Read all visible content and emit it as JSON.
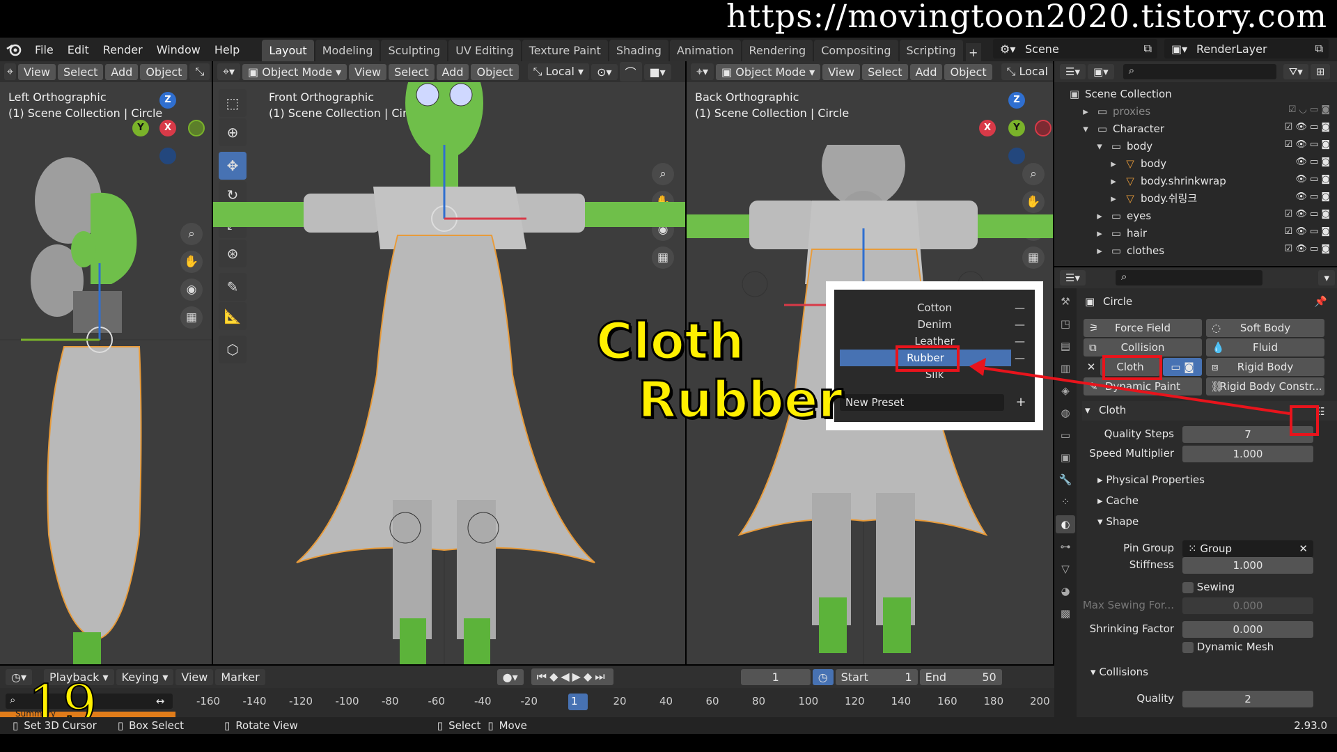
{
  "watermark_url": "https://movingtoon2020.tistory.com",
  "menu": {
    "items": [
      "File",
      "Edit",
      "Render",
      "Window",
      "Help"
    ]
  },
  "workspaces": [
    "Layout",
    "Modeling",
    "Sculpting",
    "UV Editing",
    "Texture Paint",
    "Shading",
    "Animation",
    "Rendering",
    "Compositing",
    "Scripting"
  ],
  "active_workspace": "Layout",
  "scene_name": "Scene",
  "render_layer": "RenderLayer",
  "viewports": {
    "left": {
      "menus": [
        "View",
        "Select",
        "Add",
        "Object"
      ],
      "title": "Left Orthographic",
      "subtitle": "(1) Scene Collection | Circle"
    },
    "front": {
      "mode": "Object Mode",
      "menus": [
        "View",
        "Select",
        "Add",
        "Object"
      ],
      "orientation": "Local",
      "title": "Front Orthographic",
      "subtitle": "(1) Scene Collection | Circle"
    },
    "back": {
      "mode": "Object Mode",
      "menus": [
        "View",
        "Select",
        "Add",
        "Object"
      ],
      "orientation": "Local",
      "title": "Back Orthographic",
      "subtitle": "(1) Scene Collection | Circle"
    }
  },
  "gizmo_labels": {
    "z": "Z",
    "y": "Y",
    "x": "X",
    "neg_y": "-Y",
    "neg_x": "X"
  },
  "outliner": {
    "root": "Scene Collection",
    "rows": [
      {
        "label": "proxies",
        "indent": 1
      },
      {
        "label": "Character",
        "indent": 1
      },
      {
        "label": "body",
        "indent": 2
      },
      {
        "label": "body",
        "indent": 3
      },
      {
        "label": "body.shrinkwrap",
        "indent": 3
      },
      {
        "label": "body.쉬링크",
        "indent": 3
      },
      {
        "label": "eyes",
        "indent": 2
      },
      {
        "label": "hair",
        "indent": 2
      },
      {
        "label": "clothes",
        "indent": 2
      }
    ]
  },
  "properties": {
    "object_name": "Circle",
    "physics_buttons": {
      "force_field": "Force Field",
      "soft_body": "Soft Body",
      "collision": "Collision",
      "fluid": "Fluid",
      "cloth": "Cloth",
      "rigid_body": "Rigid Body",
      "dynamic_paint": "Dynamic Paint",
      "rigid_body_constr": "Rigid Body Constr..."
    },
    "cloth_panel": "Cloth",
    "quality_steps_label": "Quality Steps",
    "quality_steps": "7",
    "speed_multiplier_label": "Speed Multiplier",
    "speed_multiplier": "1.000",
    "physical_properties": "Physical Properties",
    "cache": "Cache",
    "shape": "Shape",
    "pin_group_label": "Pin Group",
    "pin_group": "Group",
    "stiffness_label": "Stiffness",
    "stiffness": "1.000",
    "sewing": "Sewing",
    "max_sewing_label": "Max Sewing For...",
    "max_sewing": "0.000",
    "shrinking_label": "Shrinking Factor",
    "shrinking": "0.000",
    "dynamic_mesh": "Dynamic Mesh",
    "collisions": "Collisions",
    "quality_label": "Quality",
    "quality": "2"
  },
  "preset_popup": {
    "items": [
      "Cotton",
      "Denim",
      "Leather",
      "Rubber",
      "Silk"
    ],
    "selected": "Rubber",
    "new_preset": "New Preset"
  },
  "overlay": {
    "line1": "Cloth",
    "line2": "Rubber",
    "step_number": "19"
  },
  "timeline": {
    "menus": [
      "Playback",
      "Keying",
      "View",
      "Marker"
    ],
    "current_frame": "1",
    "start_label": "Start",
    "start": "1",
    "end_label": "End",
    "end": "50",
    "ticks": [
      "-160",
      "-140",
      "-120",
      "-100",
      "-80",
      "-60",
      "-40",
      "-20",
      "1",
      "20",
      "40",
      "60",
      "80",
      "100",
      "120",
      "140",
      "160",
      "180",
      "200"
    ],
    "summary_label": "Summary"
  },
  "status": {
    "items": [
      "Set 3D Cursor",
      "Box Select",
      "Rotate View",
      "Select",
      "Move"
    ],
    "version": "2.93.0"
  }
}
